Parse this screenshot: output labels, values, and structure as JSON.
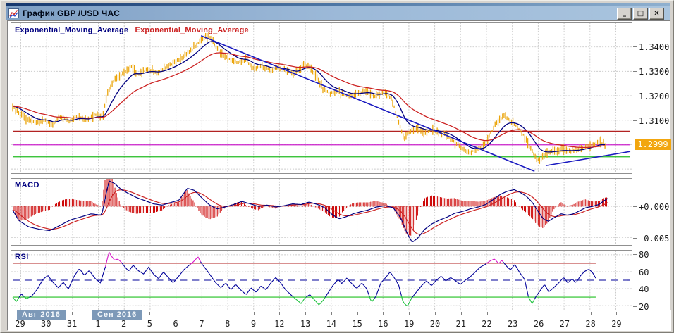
{
  "window": {
    "title": "График GBP /USD ЧАС",
    "controls": {
      "minimize": "_",
      "maximize": "□",
      "close": "✕"
    }
  },
  "panes": {
    "price": {
      "indicators": [
        {
          "label": "Exponential_Moving_Average",
          "color": "#000080"
        },
        {
          "label": "Exponential_Moving_Average",
          "color": "#cc2222"
        }
      ],
      "y_tick_labels": [
        "1.3400",
        "1.3300",
        "1.3200",
        "1.3100"
      ],
      "current_price_label": "1.2999"
    },
    "macd": {
      "label": "MACD",
      "y_tick_labels": [
        "+0.000",
        "-0.005"
      ]
    },
    "rsi": {
      "label": "RSI",
      "y_tick_labels": [
        "80",
        "60",
        "40",
        "20"
      ]
    }
  },
  "x_axis": {
    "month_badges": [
      "Авг 2016",
      "Сен 2016"
    ],
    "dates": [
      "29",
      "30",
      "31",
      "1",
      "2",
      "5",
      "6",
      "7",
      "8",
      "9",
      "12",
      "13",
      "14",
      "15",
      "16",
      "19",
      "20",
      "21",
      "22",
      "23",
      "26",
      "27",
      "28",
      "29"
    ]
  },
  "colors": {
    "candle": "#eba50b",
    "ema_fast": "#000080",
    "ema_slow": "#cc2222",
    "trendline": "#1a1ac0",
    "grid": "#cccccc",
    "macd_line": "#000080",
    "macd_signal": "#cc2222",
    "macd_histogram": "#cc0000",
    "rsi_line": "#000099",
    "rsi_overbought": "#d816c8",
    "rsi_oversold": "#1ec23e",
    "level_70": "#b02020",
    "level_30": "#20c020",
    "level_50": "#000099",
    "hline_red": "#b22222",
    "hline_magenta": "#cc22cc",
    "hline_green": "#22bb22",
    "price_tag_bg": "#f2a60e"
  },
  "chart_data": [
    {
      "type": "candlestick",
      "pane": "price",
      "symbol": "GBP/USD",
      "timeframe": "1H",
      "ylim": [
        1.2883,
        1.35
      ],
      "yticks": [
        1.34,
        1.33,
        1.32,
        1.31
      ],
      "grid_yticks": [
        1.34,
        1.33,
        1.32,
        1.31,
        1.3,
        1.29
      ],
      "plot_end": 0.959,
      "last_price": 1.2999,
      "hlines": [
        {
          "value": 1.3055,
          "color": "#b22222"
        },
        {
          "value": 1.2999,
          "color": "#cc22cc"
        },
        {
          "value": 1.295,
          "color": "#22bb22"
        }
      ],
      "trendlines": [
        {
          "x1": 0.305,
          "y1": 1.3446,
          "x2": 0.845,
          "y2": 1.2891
        },
        {
          "x1": 0.863,
          "y1": 1.2914,
          "x2": 1.0,
          "y2": 1.2972
        }
      ],
      "series": [
        {
          "name": "Exponential_Moving_Average_fast",
          "color": "#000080"
        },
        {
          "name": "Exponential_Moving_Average_slow",
          "color": "#cc2222"
        }
      ],
      "price_path": [
        [
          0,
          1.3157
        ],
        [
          0.019,
          1.3109
        ],
        [
          0.036,
          1.3089
        ],
        [
          0.053,
          1.31
        ],
        [
          0.065,
          1.308
        ],
        [
          0.076,
          1.3114
        ],
        [
          0.093,
          1.3094
        ],
        [
          0.104,
          1.3117
        ],
        [
          0.119,
          1.31
        ],
        [
          0.133,
          1.3123
        ],
        [
          0.146,
          1.3114
        ],
        [
          0.153,
          1.3214
        ],
        [
          0.167,
          1.3271
        ],
        [
          0.18,
          1.3294
        ],
        [
          0.192,
          1.3323
        ],
        [
          0.203,
          1.3286
        ],
        [
          0.218,
          1.3309
        ],
        [
          0.233,
          1.3294
        ],
        [
          0.249,
          1.3317
        ],
        [
          0.263,
          1.3337
        ],
        [
          0.278,
          1.3363
        ],
        [
          0.292,
          1.3394
        ],
        [
          0.305,
          1.3431
        ],
        [
          0.317,
          1.3446
        ],
        [
          0.326,
          1.3414
        ],
        [
          0.337,
          1.3371
        ],
        [
          0.351,
          1.3351
        ],
        [
          0.364,
          1.3334
        ],
        [
          0.377,
          1.3349
        ],
        [
          0.389,
          1.3311
        ],
        [
          0.403,
          1.3323
        ],
        [
          0.417,
          1.3303
        ],
        [
          0.43,
          1.3317
        ],
        [
          0.444,
          1.33
        ],
        [
          0.457,
          1.3291
        ],
        [
          0.471,
          1.3331
        ],
        [
          0.482,
          1.3314
        ],
        [
          0.494,
          1.3271
        ],
        [
          0.503,
          1.3226
        ],
        [
          0.514,
          1.3211
        ],
        [
          0.528,
          1.3217
        ],
        [
          0.544,
          1.3197
        ],
        [
          0.558,
          1.3211
        ],
        [
          0.573,
          1.3217
        ],
        [
          0.587,
          1.3197
        ],
        [
          0.603,
          1.3217
        ],
        [
          0.614,
          1.3183
        ],
        [
          0.624,
          1.31
        ],
        [
          0.633,
          1.3026
        ],
        [
          0.642,
          1.3049
        ],
        [
          0.655,
          1.3066
        ],
        [
          0.666,
          1.3049
        ],
        [
          0.678,
          1.306
        ],
        [
          0.69,
          1.3049
        ],
        [
          0.703,
          1.3037
        ],
        [
          0.715,
          1.3011
        ],
        [
          0.728,
          1.2983
        ],
        [
          0.739,
          1.2966
        ],
        [
          0.75,
          1.298
        ],
        [
          0.762,
          1.2991
        ],
        [
          0.773,
          1.3046
        ],
        [
          0.784,
          1.3091
        ],
        [
          0.796,
          1.3117
        ],
        [
          0.807,
          1.3097
        ],
        [
          0.818,
          1.3069
        ],
        [
          0.83,
          1.3029
        ],
        [
          0.841,
          1.2971
        ],
        [
          0.852,
          1.2934
        ],
        [
          0.863,
          1.2963
        ],
        [
          0.874,
          1.2974
        ],
        [
          0.888,
          1.298
        ],
        [
          0.901,
          1.2974
        ],
        [
          0.915,
          1.298
        ],
        [
          0.927,
          1.2989
        ],
        [
          0.939,
          1.3
        ],
        [
          0.95,
          1.3011
        ],
        [
          0.959,
          1.2999
        ]
      ]
    },
    {
      "type": "line",
      "pane": "macd",
      "name": "MACD",
      "ylim": [
        -0.00622,
        0.00444
      ],
      "yticks": [
        0.0,
        -0.005
      ],
      "plot_end": 0.964,
      "macd_path": [
        [
          0,
          -0.0006
        ],
        [
          0.01,
          -0.0023
        ],
        [
          0.026,
          -0.0033
        ],
        [
          0.044,
          -0.0037
        ],
        [
          0.06,
          -0.0039
        ],
        [
          0.076,
          -0.0031
        ],
        [
          0.093,
          -0.0022
        ],
        [
          0.11,
          -0.0017
        ],
        [
          0.127,
          -0.0012
        ],
        [
          0.144,
          -0.0014
        ],
        [
          0.156,
          0.0041
        ],
        [
          0.165,
          0.0037
        ],
        [
          0.176,
          0.0027
        ],
        [
          0.187,
          0.0021
        ],
        [
          0.201,
          0.0014
        ],
        [
          0.215,
          0.0009
        ],
        [
          0.228,
          0.0004
        ],
        [
          0.242,
          0.0002
        ],
        [
          0.255,
          0.0006
        ],
        [
          0.269,
          0.001
        ],
        [
          0.283,
          0.0029
        ],
        [
          0.294,
          0.0026
        ],
        [
          0.306,
          0.0014
        ],
        [
          0.319,
          0.0002
        ],
        [
          0.331,
          -0.0004
        ],
        [
          0.344,
          -0.0001
        ],
        [
          0.358,
          0.0003
        ],
        [
          0.371,
          0.0008
        ],
        [
          0.385,
          0.0004
        ],
        [
          0.398,
          0
        ],
        [
          0.412,
          0.0002
        ],
        [
          0.426,
          -0.0001
        ],
        [
          0.439,
          0.0001
        ],
        [
          0.453,
          0.0004
        ],
        [
          0.467,
          0.0003
        ],
        [
          0.48,
          0.0007
        ],
        [
          0.494,
          0.0003
        ],
        [
          0.505,
          -0.0002
        ],
        [
          0.516,
          -0.0012
        ],
        [
          0.528,
          -0.002
        ],
        [
          0.539,
          -0.0017
        ],
        [
          0.551,
          -0.0012
        ],
        [
          0.562,
          -0.0009
        ],
        [
          0.575,
          -0.0006
        ],
        [
          0.589,
          -0.0001
        ],
        [
          0.603,
          0.0001
        ],
        [
          0.616,
          -0.0002
        ],
        [
          0.628,
          -0.0018
        ],
        [
          0.639,
          -0.0044
        ],
        [
          0.647,
          -0.0058
        ],
        [
          0.656,
          -0.0051
        ],
        [
          0.667,
          -0.0037
        ],
        [
          0.679,
          -0.0028
        ],
        [
          0.691,
          -0.0022
        ],
        [
          0.704,
          -0.0017
        ],
        [
          0.716,
          -0.0011
        ],
        [
          0.729,
          -0.0008
        ],
        [
          0.741,
          -0.0004
        ],
        [
          0.754,
          -0.0001
        ],
        [
          0.766,
          0.0003
        ],
        [
          0.778,
          0.0011
        ],
        [
          0.789,
          0.0019
        ],
        [
          0.8,
          0.0024
        ],
        [
          0.812,
          0.0027
        ],
        [
          0.821,
          0.0023
        ],
        [
          0.832,
          0.0016
        ],
        [
          0.841,
          0.0007
        ],
        [
          0.85,
          -0.0007
        ],
        [
          0.859,
          -0.002
        ],
        [
          0.867,
          -0.0024
        ],
        [
          0.877,
          -0.0018
        ],
        [
          0.888,
          -0.0012
        ],
        [
          0.898,
          -0.0014
        ],
        [
          0.908,
          -0.0012
        ],
        [
          0.918,
          -0.0007
        ],
        [
          0.928,
          -0.0002
        ],
        [
          0.939,
          0
        ],
        [
          0.949,
          0.0003
        ],
        [
          0.959,
          0.001
        ],
        [
          0.964,
          0.0013
        ]
      ]
    },
    {
      "type": "line",
      "pane": "rsi",
      "name": "RSI",
      "ylim": [
        15.1,
        84.9
      ],
      "yticks": [
        80,
        60,
        40,
        20
      ],
      "levels": [
        {
          "value": 70,
          "color": "#b02020",
          "style": "solid"
        },
        {
          "value": 50,
          "color": "#000099",
          "style": "dashed"
        },
        {
          "value": 30,
          "color": "#20c020",
          "style": "solid"
        }
      ],
      "plot_end": 0.944,
      "rsi_path": [
        [
          0,
          29.7
        ],
        [
          0.006,
          24.9
        ],
        [
          0.014,
          33.8
        ],
        [
          0.022,
          28.1
        ],
        [
          0.031,
          31.4
        ],
        [
          0.04,
          39.5
        ],
        [
          0.049,
          50.8
        ],
        [
          0.057,
          55.7
        ],
        [
          0.065,
          47.6
        ],
        [
          0.074,
          41.1
        ],
        [
          0.082,
          47.6
        ],
        [
          0.09,
          39.5
        ],
        [
          0.099,
          54.1
        ],
        [
          0.108,
          63.8
        ],
        [
          0.116,
          55.7
        ],
        [
          0.124,
          61.4
        ],
        [
          0.133,
          52.4
        ],
        [
          0.142,
          46.8
        ],
        [
          0.15,
          65.4
        ],
        [
          0.156,
          83.2
        ],
        [
          0.16,
          78.4
        ],
        [
          0.165,
          73.5
        ],
        [
          0.17,
          75.1
        ],
        [
          0.176,
          71.1
        ],
        [
          0.182,
          65.4
        ],
        [
          0.188,
          60.5
        ],
        [
          0.195,
          67.8
        ],
        [
          0.203,
          61.4
        ],
        [
          0.212,
          57.3
        ],
        [
          0.22,
          65.4
        ],
        [
          0.228,
          57.3
        ],
        [
          0.236,
          51.6
        ],
        [
          0.244,
          59.7
        ],
        [
          0.252,
          53.2
        ],
        [
          0.26,
          46.8
        ],
        [
          0.269,
          54.9
        ],
        [
          0.278,
          63
        ],
        [
          0.286,
          67.8
        ],
        [
          0.293,
          71.9
        ],
        [
          0.3,
          77.6
        ],
        [
          0.306,
          69.5
        ],
        [
          0.313,
          63
        ],
        [
          0.321,
          54.9
        ],
        [
          0.329,
          46.8
        ],
        [
          0.337,
          41.1
        ],
        [
          0.345,
          46.8
        ],
        [
          0.353,
          38.6
        ],
        [
          0.361,
          45.1
        ],
        [
          0.369,
          38.6
        ],
        [
          0.378,
          33
        ],
        [
          0.386,
          41.1
        ],
        [
          0.394,
          35.4
        ],
        [
          0.402,
          43.5
        ],
        [
          0.41,
          38.6
        ],
        [
          0.418,
          46.8
        ],
        [
          0.426,
          53.2
        ],
        [
          0.434,
          46.8
        ],
        [
          0.442,
          38.6
        ],
        [
          0.45,
          33
        ],
        [
          0.459,
          27.3
        ],
        [
          0.467,
          22.4
        ],
        [
          0.473,
          28.9
        ],
        [
          0.481,
          33
        ],
        [
          0.489,
          26.5
        ],
        [
          0.496,
          20.8
        ],
        [
          0.503,
          26.5
        ],
        [
          0.511,
          35.4
        ],
        [
          0.519,
          44.3
        ],
        [
          0.527,
          50.8
        ],
        [
          0.533,
          46
        ],
        [
          0.541,
          52.4
        ],
        [
          0.549,
          46
        ],
        [
          0.557,
          40.3
        ],
        [
          0.565,
          46.8
        ],
        [
          0.573,
          40.3
        ],
        [
          0.581,
          24.1
        ],
        [
          0.588,
          30.5
        ],
        [
          0.596,
          46.8
        ],
        [
          0.604,
          53.2
        ],
        [
          0.611,
          59.7
        ],
        [
          0.619,
          51.6
        ],
        [
          0.625,
          44.3
        ],
        [
          0.632,
          24.1
        ],
        [
          0.639,
          19.2
        ],
        [
          0.646,
          28.9
        ],
        [
          0.654,
          36.2
        ],
        [
          0.662,
          43.5
        ],
        [
          0.67,
          49.2
        ],
        [
          0.678,
          43.5
        ],
        [
          0.686,
          50
        ],
        [
          0.694,
          54.9
        ],
        [
          0.701,
          49.2
        ],
        [
          0.709,
          53.2
        ],
        [
          0.717,
          49.2
        ],
        [
          0.725,
          45.1
        ],
        [
          0.733,
          50
        ],
        [
          0.741,
          54.1
        ],
        [
          0.749,
          59.7
        ],
        [
          0.757,
          65.4
        ],
        [
          0.765,
          68.6
        ],
        [
          0.773,
          72.7
        ],
        [
          0.78,
          75.1
        ],
        [
          0.787,
          69.5
        ],
        [
          0.792,
          73.5
        ],
        [
          0.799,
          67
        ],
        [
          0.806,
          62.2
        ],
        [
          0.813,
          68.6
        ],
        [
          0.821,
          58.9
        ],
        [
          0.829,
          50.8
        ],
        [
          0.835,
          30.5
        ],
        [
          0.841,
          22.4
        ],
        [
          0.847,
          30.5
        ],
        [
          0.855,
          38.6
        ],
        [
          0.861,
          45.1
        ],
        [
          0.868,
          36.2
        ],
        [
          0.876,
          41.1
        ],
        [
          0.884,
          46.8
        ],
        [
          0.892,
          53.2
        ],
        [
          0.899,
          46.8
        ],
        [
          0.906,
          51.6
        ],
        [
          0.912,
          46.8
        ],
        [
          0.919,
          54.9
        ],
        [
          0.926,
          60.5
        ],
        [
          0.933,
          63
        ],
        [
          0.939,
          58.9
        ],
        [
          0.944,
          52.4
        ]
      ]
    }
  ]
}
